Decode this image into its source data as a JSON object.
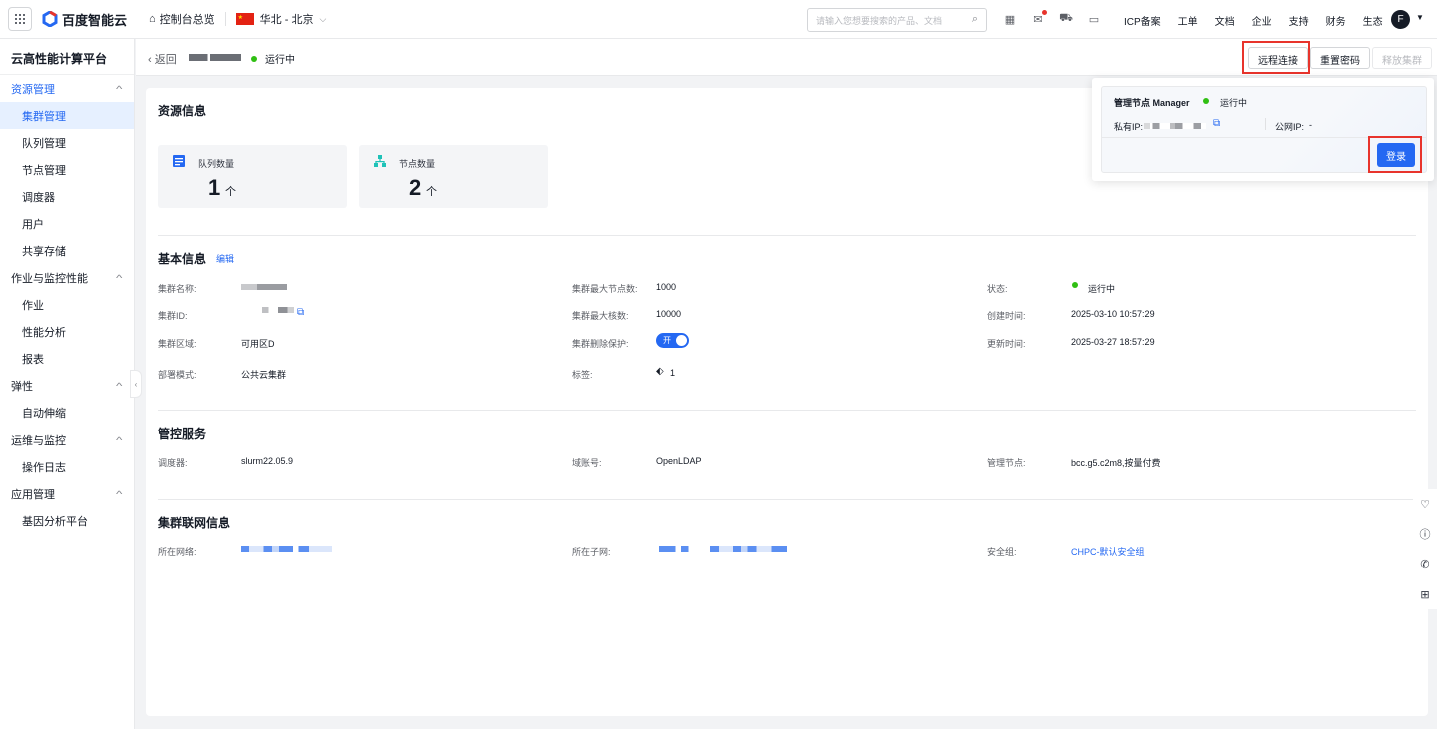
{
  "topbar": {
    "brand": "百度智能云",
    "console": "控制台总览",
    "region": "华北 - 北京",
    "search_placeholder": "请输入您想要搜索的产品、文档",
    "menu": [
      "ICP备案",
      "工单",
      "文档",
      "企业",
      "支持",
      "财务",
      "生态"
    ],
    "avatar_letter": "F"
  },
  "sidebar": {
    "title": "云高性能计算平台",
    "groups": [
      {
        "label": "资源管理",
        "items": [
          "集群管理",
          "队列管理",
          "节点管理",
          "调度器",
          "用户",
          "共享存储"
        ]
      },
      {
        "label": "作业与监控性能",
        "items": [
          "作业",
          "性能分析",
          "报表"
        ]
      },
      {
        "label": "弹性",
        "items": [
          "自动伸缩"
        ]
      },
      {
        "label": "运维与监控",
        "items": [
          "操作日志"
        ]
      },
      {
        "label": "应用管理",
        "items": [
          "基因分析平台"
        ]
      }
    ]
  },
  "header": {
    "back": "返回",
    "status": "运行中",
    "btn_remote": "远程连接",
    "btn_reset": "重置密码",
    "btn_release": "释放集群"
  },
  "resource": {
    "title": "资源信息",
    "queue_label": "队列数量",
    "queue_value": "1",
    "node_label": "节点数量",
    "node_value": "2",
    "unit": "个"
  },
  "basic": {
    "title": "基本信息",
    "edit": "编辑",
    "name_label": "集群名称:",
    "id_label": "集群ID:",
    "zone_label": "集群区域:",
    "zone_value": "可用区D",
    "deploy_label": "部署模式:",
    "deploy_value": "公共云集群",
    "max_nodes_label": "集群最大节点数:",
    "max_nodes_value": "1000",
    "max_cores_label": "集群最大核数:",
    "max_cores_value": "10000",
    "protect_label": "集群删除保护:",
    "protect_value": "开",
    "tags_label": "标签:",
    "tags_value": "1",
    "status_label": "状态:",
    "status_value": "运行中",
    "created_label": "创建时间:",
    "created_value": "2025-03-10 10:57:29",
    "updated_label": "更新时间:",
    "updated_value": "2025-03-27 18:57:29"
  },
  "control": {
    "title": "管控服务",
    "scheduler_label": "调度器:",
    "scheduler_value": "slurm22.05.9",
    "domain_label": "域账号:",
    "domain_value": "OpenLDAP",
    "manager_label": "管理节点:",
    "manager_value": "bcc.g5.c2m8,按量付费"
  },
  "network": {
    "title": "集群联网信息",
    "vpc_label": "所在网络:",
    "subnet_label": "所在子网:",
    "sg_label": "安全组:",
    "sg_value": "CHPC-默认安全组"
  },
  "popover": {
    "title": "管理节点 Manager",
    "status": "运行中",
    "private_ip_label": "私有IP:",
    "public_ip_label": "公网IP:",
    "public_ip_value": "-",
    "login": "登录"
  },
  "colors": {
    "accent": "#2468f2",
    "running": "#30bf13",
    "highlight": "#e8342c"
  }
}
